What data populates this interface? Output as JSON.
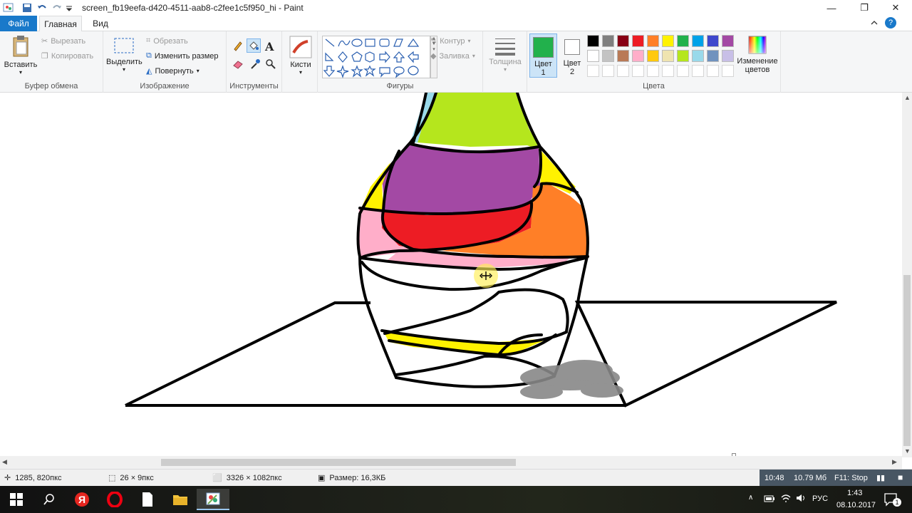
{
  "window": {
    "title": "screen_fb19eefa-d420-4511-aab8-c2fee1c5f950_hi - Paint",
    "minimize": "—",
    "maximize": "❐",
    "close": "✕"
  },
  "menu": {
    "file": "Файл",
    "tabs": [
      "Главная",
      "Вид"
    ],
    "help": "?"
  },
  "ribbon": {
    "clipboard": {
      "label": "Буфер обмена",
      "paste": "Вставить",
      "cut": "Вырезать",
      "copy": "Копировать"
    },
    "image": {
      "label": "Изображение",
      "select": "Выделить",
      "crop": "Обрезать",
      "resize": "Изменить размер",
      "rotate": "Повернуть"
    },
    "tools": {
      "label": "Инструменты"
    },
    "brushes": {
      "label": "Кисти"
    },
    "shapes": {
      "label": "Фигуры",
      "outline": "Контур",
      "fill": "Заливка"
    },
    "size": {
      "label": "Толщина"
    },
    "colors": {
      "label": "Цвета",
      "color1": "Цвет",
      "color1_num": "1",
      "color2": "Цвет",
      "color2_num": "2",
      "edit_colors": "Изменение",
      "edit_colors_2": "цветов",
      "color1_value": "#22b14c",
      "color2_value": "#ffffff",
      "palette_row1": [
        "#000000",
        "#7f7f7f",
        "#880015",
        "#ed1c24",
        "#ff7f27",
        "#fff200",
        "#22b14c",
        "#00a2e8",
        "#3f48cc",
        "#a349a4"
      ],
      "palette_row2": [
        "#ffffff",
        "#c3c3c3",
        "#b97a57",
        "#ffaec9",
        "#ffc90e",
        "#efe4b0",
        "#b5e61d",
        "#99d9ea",
        "#7092be",
        "#c8bfe7"
      ]
    }
  },
  "status": {
    "cursor_pos": "1285, 820пкс",
    "selection_size": "26 × 9пкс",
    "image_size": "3326 × 1082пкс",
    "file_size": "Размер: 16,3КБ"
  },
  "recorder": {
    "time": "10:48",
    "memory": "10.79 Мб",
    "stop": "F11: Stop"
  },
  "tray": {
    "lang": "РУС",
    "time": "1:43",
    "date": "08.10.2017",
    "notif_count": "1"
  }
}
